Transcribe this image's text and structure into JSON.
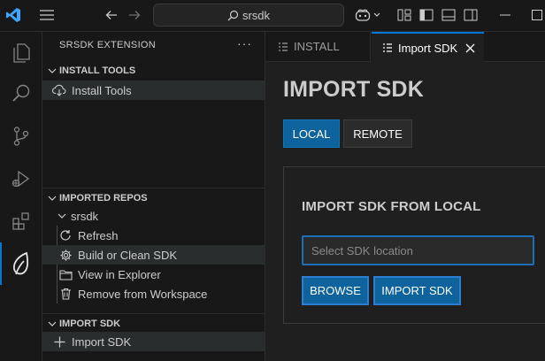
{
  "titlebar": {
    "search_text": "srsdk"
  },
  "sidebar": {
    "title": "SRSDK EXTENSION",
    "more": "···",
    "sections": {
      "install_tools": {
        "header": "INSTALL TOOLS",
        "items": [
          {
            "label": "Install Tools",
            "icon": "cloud-download-icon"
          }
        ]
      },
      "imported_repos": {
        "header": "IMPORTED REPOS",
        "repo": "srsdk",
        "items": [
          {
            "label": "Refresh",
            "icon": "refresh-icon"
          },
          {
            "label": "Build or Clean SDK",
            "icon": "gear-icon"
          },
          {
            "label": "View in Explorer",
            "icon": "folder-icon"
          },
          {
            "label": "Remove from Workspace",
            "icon": "trash-icon"
          }
        ]
      },
      "import_sdk": {
        "header": "IMPORT SDK",
        "items": [
          {
            "label": "Import SDK",
            "icon": "plus-icon"
          }
        ]
      }
    }
  },
  "tabs": [
    {
      "label": "INSTALL",
      "active": false
    },
    {
      "label": "Import SDK",
      "active": true
    }
  ],
  "editor": {
    "title": "IMPORT SDK",
    "mode_buttons": {
      "local": "LOCAL",
      "remote": "REMOTE",
      "selected": "LOCAL"
    },
    "panel": {
      "title": "IMPORT SDK FROM LOCAL",
      "input_value": "",
      "input_placeholder": "Select SDK location",
      "browse_label": "BROWSE",
      "import_label": "IMPORT SDK"
    }
  },
  "colors": {
    "accent": "#0078d4",
    "button_bg": "#0e639c",
    "background": "#1f1f1f",
    "sidebar_bg": "#181818"
  }
}
